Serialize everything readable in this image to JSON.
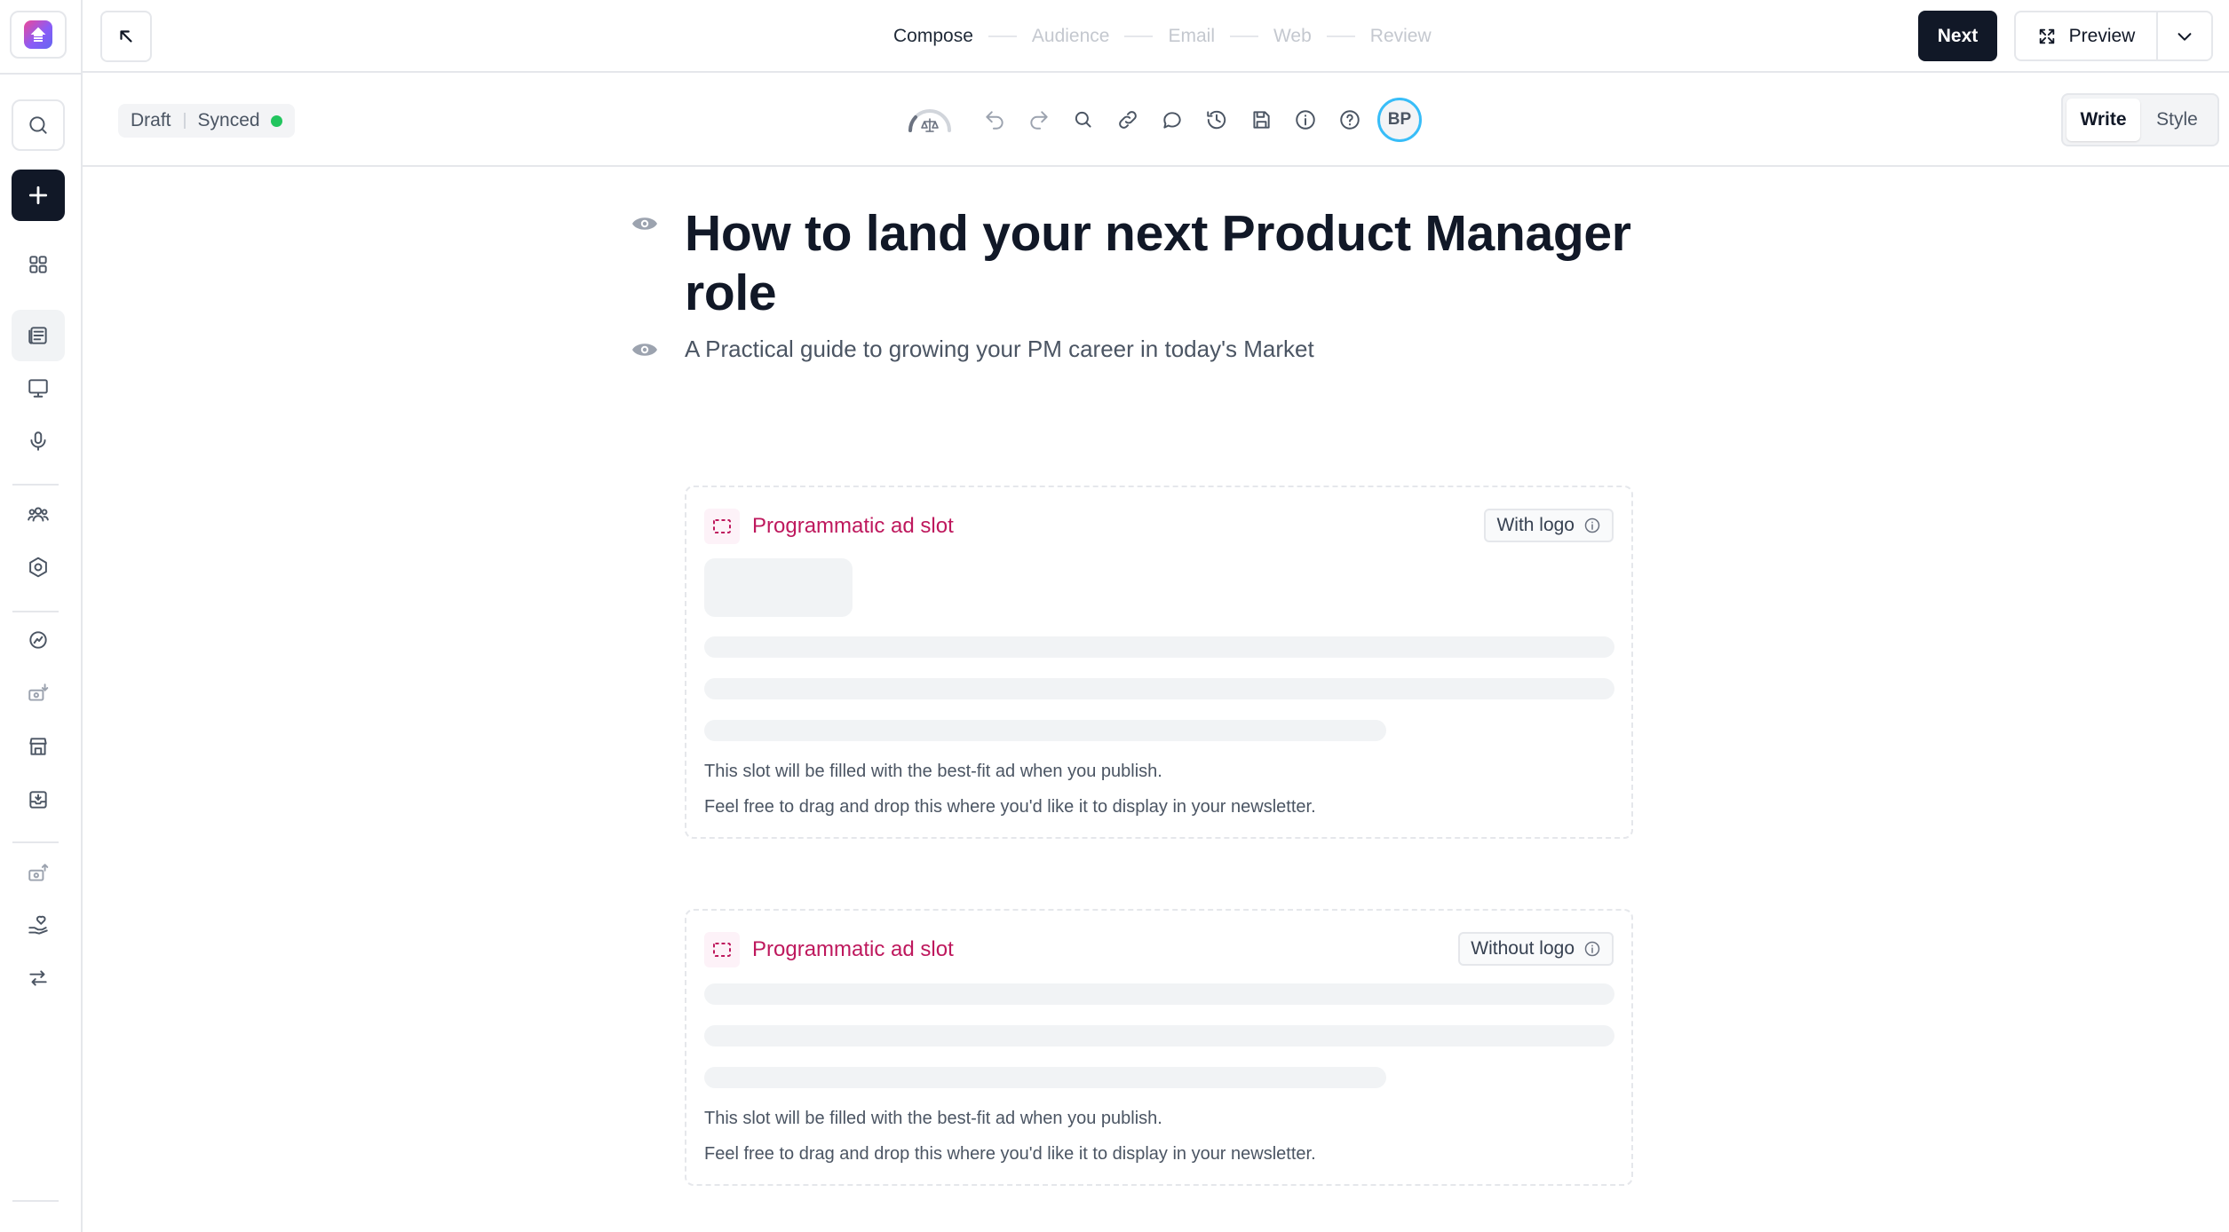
{
  "topbar": {
    "steps": [
      "Compose",
      "Audience",
      "Email",
      "Web",
      "Review"
    ],
    "current_step": "Compose",
    "next_label": "Next",
    "preview_label": "Preview"
  },
  "toolbar": {
    "status_draft": "Draft",
    "status_synced": "Synced",
    "avatar_initials": "BP",
    "mode_write": "Write",
    "mode_style": "Style",
    "active_mode": "Write"
  },
  "post": {
    "title": "How to land your next Product Manager role",
    "subtitle": "A Practical guide to growing your PM career in today's Market"
  },
  "ad_slots": [
    {
      "title": "Programmatic ad slot",
      "badge": "With logo",
      "note_1": "This slot will be filled with the best-fit ad when you publish.",
      "note_2": "Feel free to drag and drop this where you'd like it to display in your newsletter."
    },
    {
      "title": "Programmatic ad slot",
      "badge": "Without logo",
      "note_1": "This slot will be filled with the best-fit ad when you publish.",
      "note_2": "Feel free to drag and drop this where you'd like it to display in your newsletter."
    }
  ],
  "colors": {
    "accent": "#be185d",
    "primary_button": "#111827",
    "status_ok": "#22c55e",
    "avatar_ring": "#38bdf8"
  },
  "icons": {
    "sidebar": [
      "search-icon",
      "plus-icon",
      "grid-icon",
      "posts-icon",
      "website-icon",
      "podcast-icon",
      "audience-icon",
      "settings-icon",
      "grow-icon",
      "monetize-icon",
      "shop-icon",
      "inbox-icon",
      "export-icon",
      "donate-icon",
      "automation-icon"
    ],
    "toolbar": [
      "gauge-icon",
      "undo-icon",
      "redo-icon",
      "search-icon",
      "link-icon",
      "comment-icon",
      "history-icon",
      "save-icon",
      "info-icon",
      "help-icon"
    ]
  }
}
